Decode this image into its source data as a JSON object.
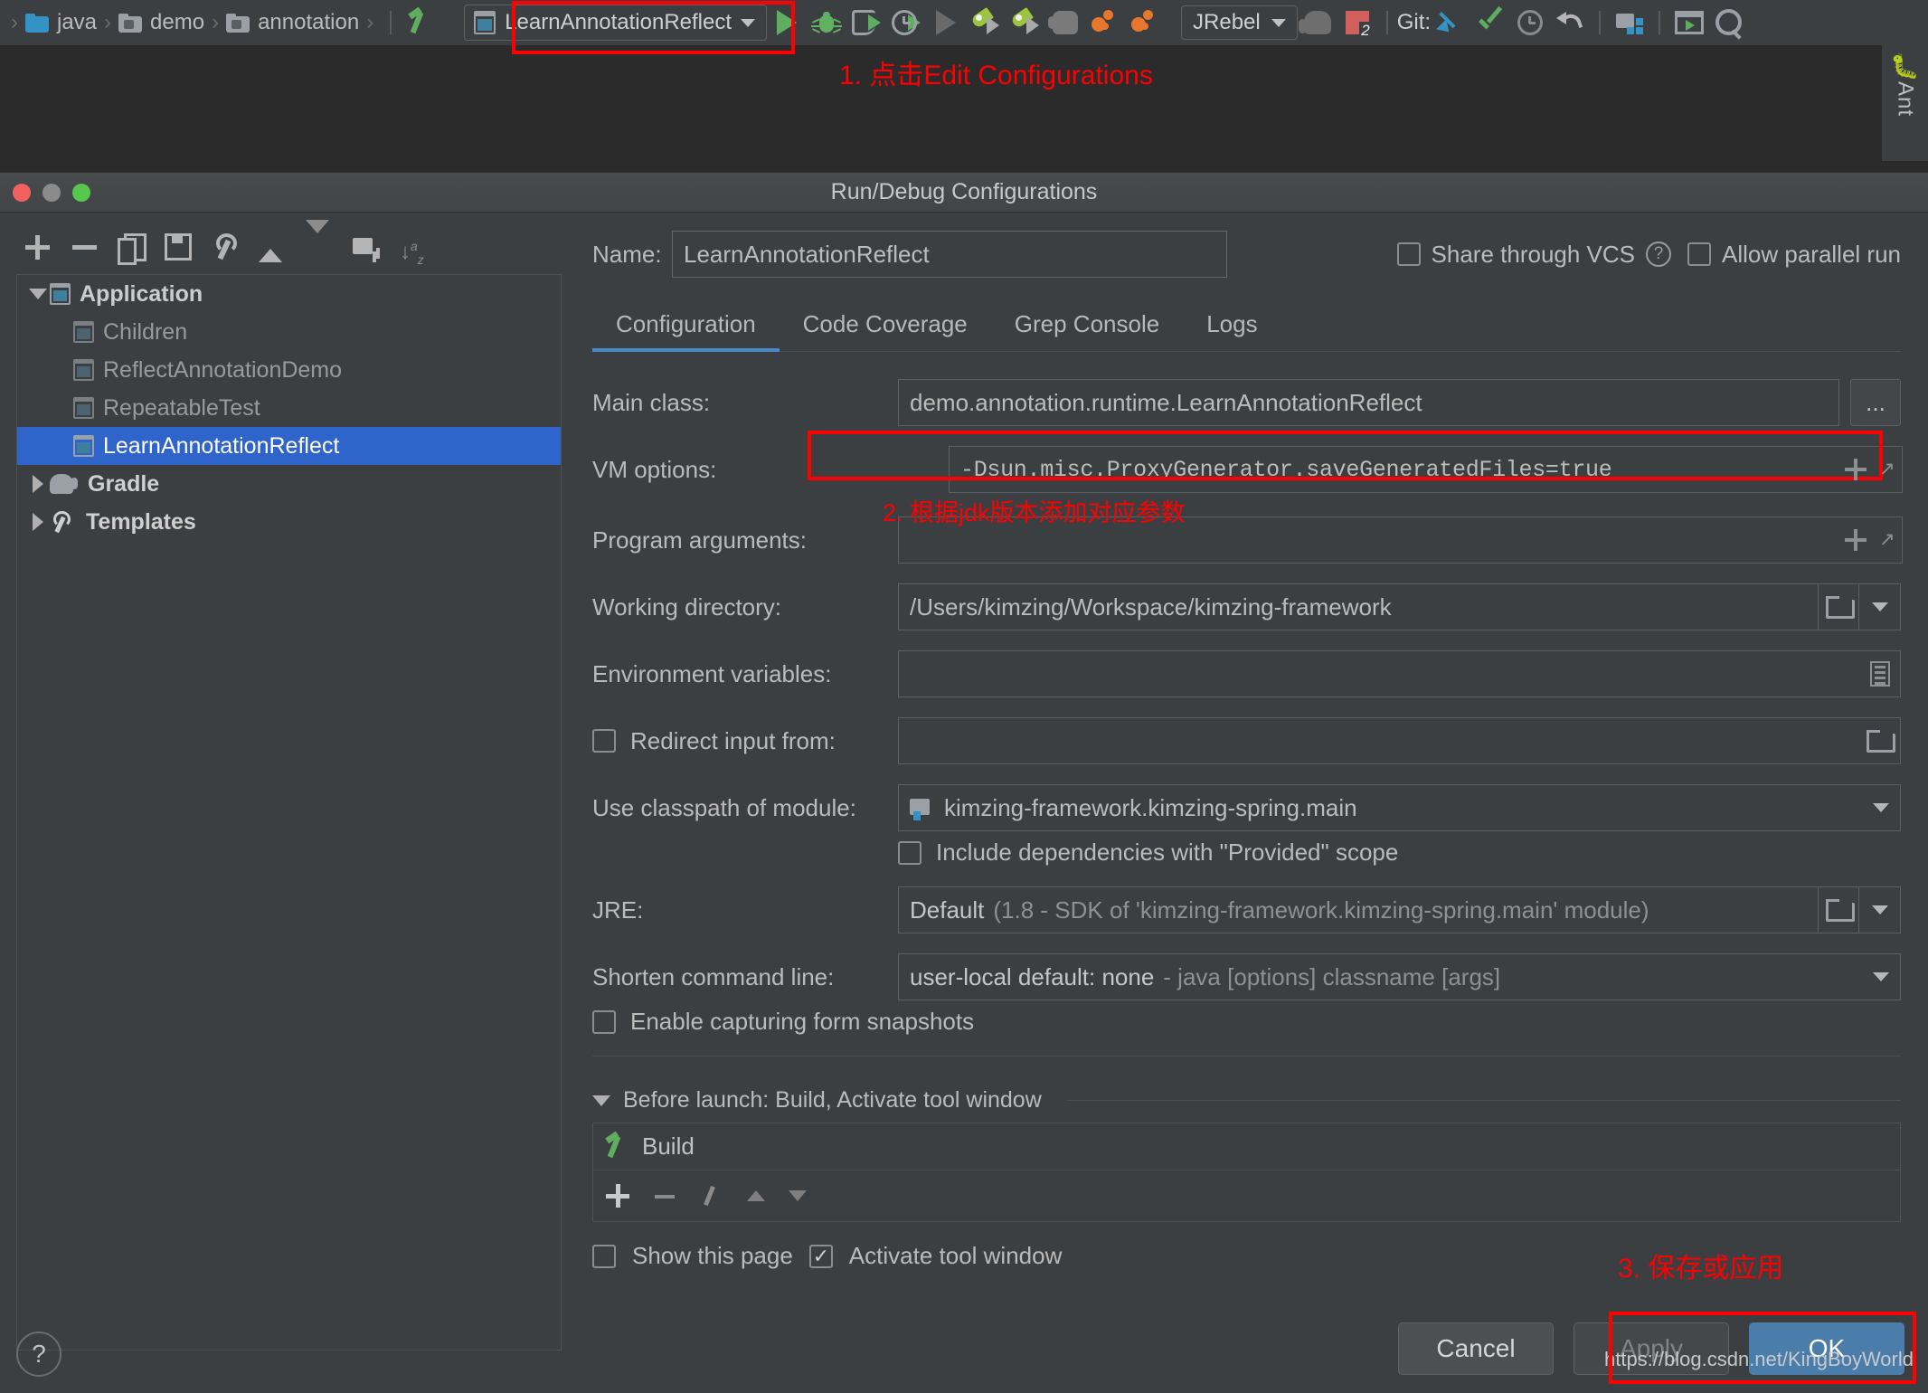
{
  "ide": {
    "breadcrumb": [
      {
        "label": "java",
        "icon": "folder-blue-icon"
      },
      {
        "label": "demo",
        "icon": "folder-icon"
      },
      {
        "label": "annotation",
        "icon": "folder-icon"
      }
    ],
    "breadcrumb_separator": "›",
    "run_config": {
      "label": "LearnAnnotationReflect",
      "icon": "application-config-icon",
      "caret": "chevron-down-icon"
    },
    "toolbar_icons": [
      "run-icon",
      "debug-icon",
      "run-with-coverage-icon",
      "profile-icon",
      "run-gray-icon",
      "rocket-run-icon",
      "rocket-debug-icon",
      "stop-hand-icon",
      "orange-run-icon",
      "orange-debug-icon"
    ],
    "jrebel": {
      "label": "JRebel",
      "caret": "chevron-down-icon"
    },
    "problems_count": "2",
    "git_label": "Git:",
    "right_icons": [
      "update-project-icon",
      "commit-icon",
      "history-icon",
      "rollback-icon",
      "project-structure-icon",
      "run-window-icon",
      "search-everywhere-icon"
    ],
    "tool_window": {
      "label": "Ant",
      "icon": "ant-icon"
    }
  },
  "annotations": {
    "step1": "1. 点击Edit Configurations",
    "step2": "2. 根据jdk版本添加对应参数",
    "step3": "3. 保存或应用"
  },
  "dialog": {
    "title": "Run/Debug Configurations",
    "traffic_lights": [
      "close",
      "minimize",
      "zoom"
    ],
    "tree_toolbar": [
      "add-icon",
      "remove-icon",
      "copy-icon",
      "save-icon",
      "edit-templates-icon",
      "move-up-icon",
      "move-down-icon",
      "new-folder-icon",
      "sort-icon"
    ],
    "tree": [
      {
        "label": "Application",
        "level": 0,
        "expanded": true,
        "icon": "application-icon",
        "selected": false,
        "bold": true
      },
      {
        "label": "Children",
        "level": 1,
        "icon": "application-icon",
        "selected": false
      },
      {
        "label": "ReflectAnnotationDemo",
        "level": 1,
        "icon": "application-icon",
        "selected": false
      },
      {
        "label": "RepeatableTest",
        "level": 1,
        "icon": "application-icon",
        "selected": false
      },
      {
        "label": "LearnAnnotationReflect",
        "level": 1,
        "icon": "application-icon",
        "selected": true
      },
      {
        "label": "Gradle",
        "level": 0,
        "expanded": false,
        "icon": "gradle-icon",
        "selected": false,
        "bold": true
      },
      {
        "label": "Templates",
        "level": 0,
        "expanded": false,
        "icon": "templates-icon",
        "selected": false,
        "bold": true
      }
    ],
    "name": {
      "label": "Name:",
      "value": "LearnAnnotationReflect"
    },
    "share_through_vcs": {
      "label": "Share through VCS",
      "checked": false,
      "help": "?"
    },
    "allow_parallel_run": {
      "label": "Allow parallel run",
      "checked": false
    },
    "tabs": [
      {
        "label": "Configuration",
        "active": true
      },
      {
        "label": "Code Coverage",
        "active": false
      },
      {
        "label": "Grep Console",
        "active": false
      },
      {
        "label": "Logs",
        "active": false
      }
    ],
    "fields": {
      "main_class": {
        "label": "Main class:",
        "value": "demo.annotation.runtime.LearnAnnotationReflect",
        "browse": "..."
      },
      "vm_options": {
        "label": "VM options:",
        "value": "-Dsun.misc.ProxyGenerator.saveGeneratedFiles=true"
      },
      "program_arguments": {
        "label": "Program arguments:",
        "value": ""
      },
      "working_directory": {
        "label": "Working directory:",
        "value": "/Users/kimzing/Workspace/kimzing-framework"
      },
      "environment_variables": {
        "label": "Environment variables:",
        "value": ""
      },
      "redirect_input_from": {
        "label": "Redirect input from:",
        "checked": false,
        "value": ""
      },
      "use_classpath_of_module": {
        "label": "Use classpath of module:",
        "value": "kimzing-framework.kimzing-spring.main"
      },
      "include_provided": {
        "label": "Include dependencies with \"Provided\" scope",
        "checked": false
      },
      "jre": {
        "label": "JRE:",
        "value": "Default",
        "hint": "(1.8 - SDK of 'kimzing-framework.kimzing-spring.main' module)"
      },
      "shorten_command_line": {
        "label": "Shorten command line:",
        "value": "user-local default: none",
        "hint": "- java [options] classname [args]"
      },
      "enable_capturing": {
        "label": "Enable capturing form snapshots",
        "checked": false
      }
    },
    "before_launch": {
      "header": "Before launch: Build, Activate tool window",
      "items": [
        {
          "label": "Build",
          "icon": "build-hammer-icon"
        }
      ],
      "toolbar": [
        "add-icon",
        "remove-icon",
        "edit-icon",
        "move-up-icon",
        "move-down-icon"
      ],
      "show_this_page": {
        "label": "Show this page",
        "checked": false
      },
      "activate_tool_window": {
        "label": "Activate tool window",
        "checked": true
      }
    },
    "footer": {
      "help": "?",
      "cancel": "Cancel",
      "apply": "Apply",
      "ok": "OK"
    }
  },
  "watermark": "https://blog.csdn.net/KingBoyWorld",
  "colors": {
    "accent_blue": "#2f65ca",
    "tab_underline": "#4a88c7",
    "annotation_red": "#ff0000",
    "ok_button": "#4a7daa",
    "panel_bg": "#3c3f41",
    "editor_bg": "#2b2b2b"
  }
}
